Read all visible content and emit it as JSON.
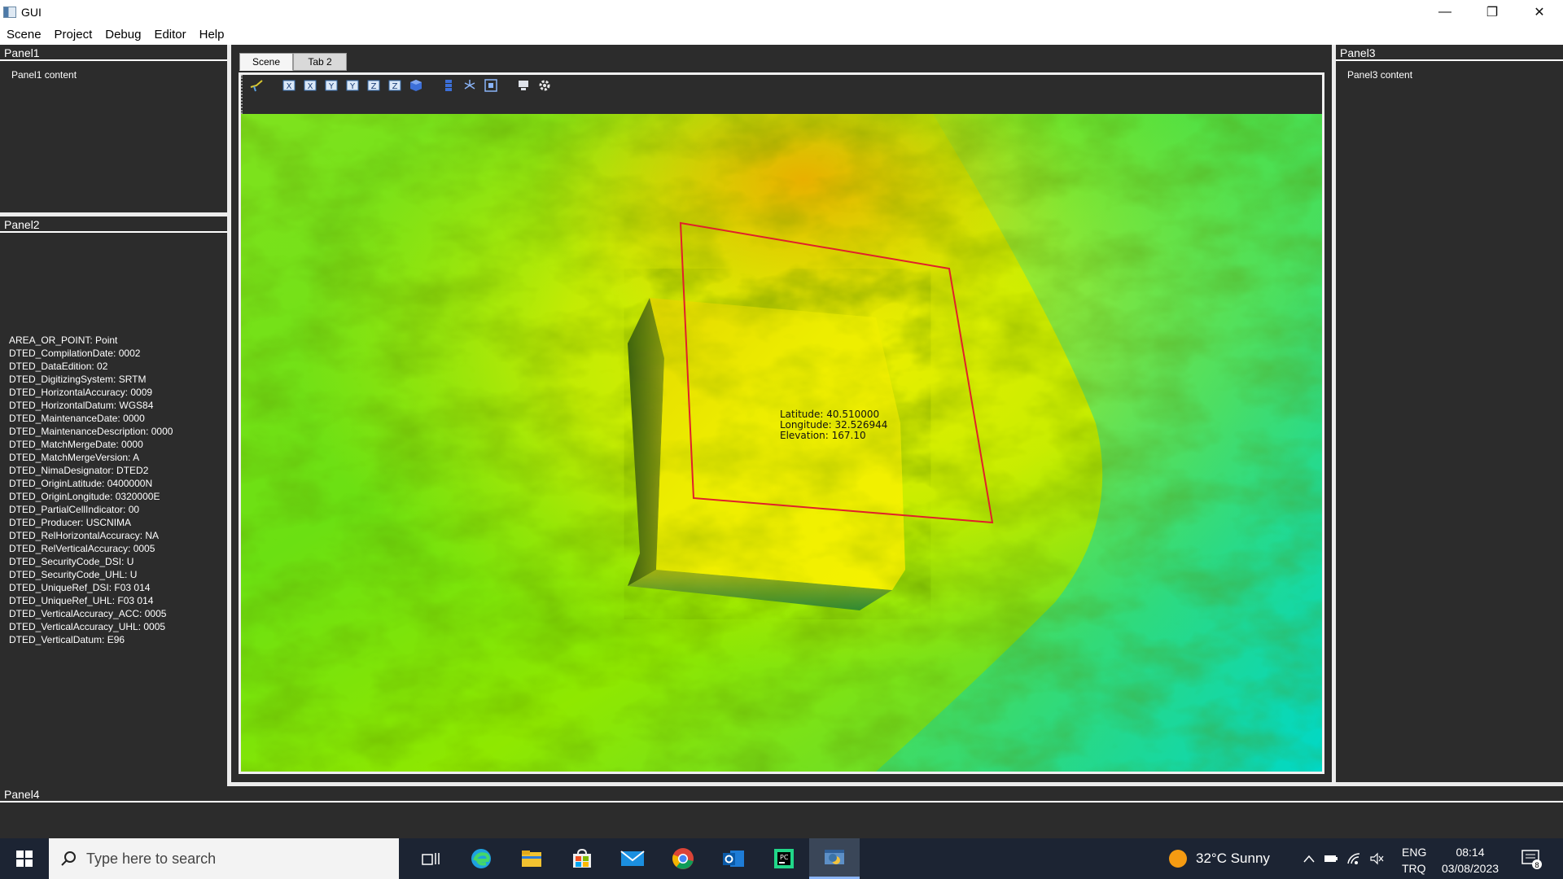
{
  "window": {
    "title": "GUI",
    "minimize": "—",
    "restore": "❐",
    "close": "✕"
  },
  "menu": [
    "Scene",
    "Project",
    "Debug",
    "Editor",
    "Help"
  ],
  "panel1": {
    "title": "Panel1",
    "content": "Panel1 content"
  },
  "panel2": {
    "title": "Panel2",
    "metadata": [
      "AREA_OR_POINT: Point",
      "DTED_CompilationDate: 0002",
      "DTED_DataEdition: 02",
      "DTED_DigitizingSystem: SRTM",
      "DTED_HorizontalAccuracy: 0009",
      "DTED_HorizontalDatum: WGS84",
      "DTED_MaintenanceDate: 0000",
      "DTED_MaintenanceDescription: 0000",
      "DTED_MatchMergeDate: 0000",
      "DTED_MatchMergeVersion: A",
      "DTED_NimaDesignator: DTED2",
      "DTED_OriginLatitude: 0400000N",
      "DTED_OriginLongitude: 0320000E",
      "DTED_PartialCellIndicator: 00",
      "DTED_Producer: USCNIMA",
      "DTED_RelHorizontalAccuracy: NA",
      "DTED_RelVerticalAccuracy: 0005",
      "DTED_SecurityCode_DSI: U",
      "DTED_SecurityCode_UHL: U",
      "DTED_UniqueRef_DSI: F03 014",
      "DTED_UniqueRef_UHL: F03 014",
      "DTED_VerticalAccuracy_ACC: 0005",
      "DTED_VerticalAccuracy_UHL: 0005",
      "DTED_VerticalDatum: E96"
    ]
  },
  "panel3": {
    "title": "Panel3",
    "content": "Panel3 content"
  },
  "panel4": {
    "title": "Panel4"
  },
  "tabs": [
    "Scene",
    "Tab 2"
  ],
  "toolbar_icons": [
    "pointer-icon",
    "view-x-pos-icon",
    "view-x-neg-icon",
    "view-y-pos-icon",
    "view-y-neg-icon",
    "view-z-pos-icon",
    "view-z-neg-icon",
    "cube-icon",
    "layers-icon",
    "axes-icon",
    "fit-view-icon",
    "screenshot-icon",
    "settings-icon"
  ],
  "toolbar_labels": {
    "x1": "X",
    "x2": "X",
    "y1": "Y",
    "y2": "Y",
    "z1": "Z",
    "z2": "Z"
  },
  "scene": {
    "latitude": "Latitude: 40.510000",
    "longitude": "Longitude: 32.526944",
    "elevation": "Elevation: 167.10",
    "selection_color": "#e0202a"
  },
  "taskbar": {
    "search_placeholder": "Type here to search",
    "weather": "32°C  Sunny",
    "lang1": "ENG",
    "lang2": "TRQ",
    "time": "08:14",
    "date": "03/08/2023",
    "notifications": "8"
  }
}
